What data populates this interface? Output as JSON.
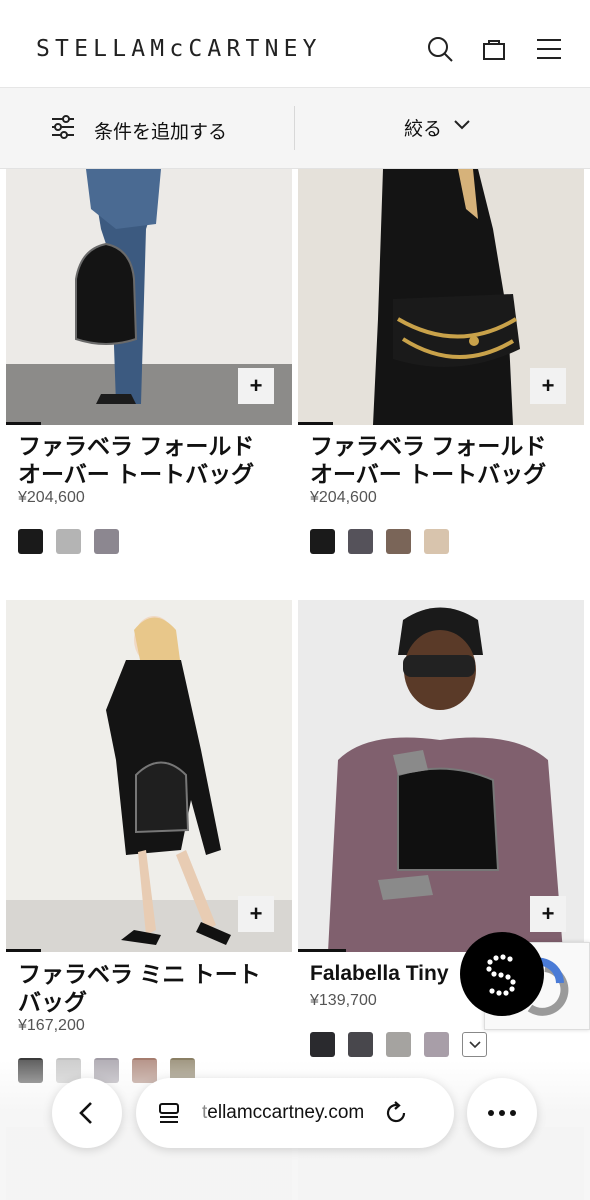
{
  "header": {
    "logo": "STELLAMcCARTNEY",
    "icons": [
      "search-icon",
      "bag-icon",
      "menu-icon"
    ]
  },
  "filterbar": {
    "add_filter_label": "条件を追加する",
    "refine_label": "絞る"
  },
  "products": [
    {
      "title_line1": "ファラベラ フォールド",
      "title_line2": "オーバー トートバッグ",
      "price": "¥204,600",
      "swatches": [
        "#1a1a1a",
        "#b4b4b4",
        "#8c8790"
      ]
    },
    {
      "title_line1": "ファラベラ フォールド",
      "title_line2": "オーバー トートバッグ",
      "price": "¥204,600",
      "swatches": [
        "#1a1a1a",
        "#55525a",
        "#7a6558",
        "#d8c4ad"
      ]
    },
    {
      "title_line1": "ファラベラ ミニ トート",
      "title_line2": "バッグ",
      "price": "¥167,200",
      "swatches": [
        "#3a3a3a",
        "#c2c2c2",
        "#a09ba4",
        "#a57c6e",
        "#8a7f64"
      ]
    },
    {
      "title_line1": "Falabella Tiny",
      "title_line2": "",
      "price": "¥139,700",
      "swatches": [
        "#2a2a2e",
        "#48474c",
        "#a5a3a0",
        "#a89ea8"
      ]
    }
  ],
  "browser": {
    "url_dim": "t",
    "url_main": "ellamccartney.com"
  },
  "colors": {
    "filter_bg": "#f5f5f5",
    "text": "#111111",
    "price": "#555555"
  }
}
